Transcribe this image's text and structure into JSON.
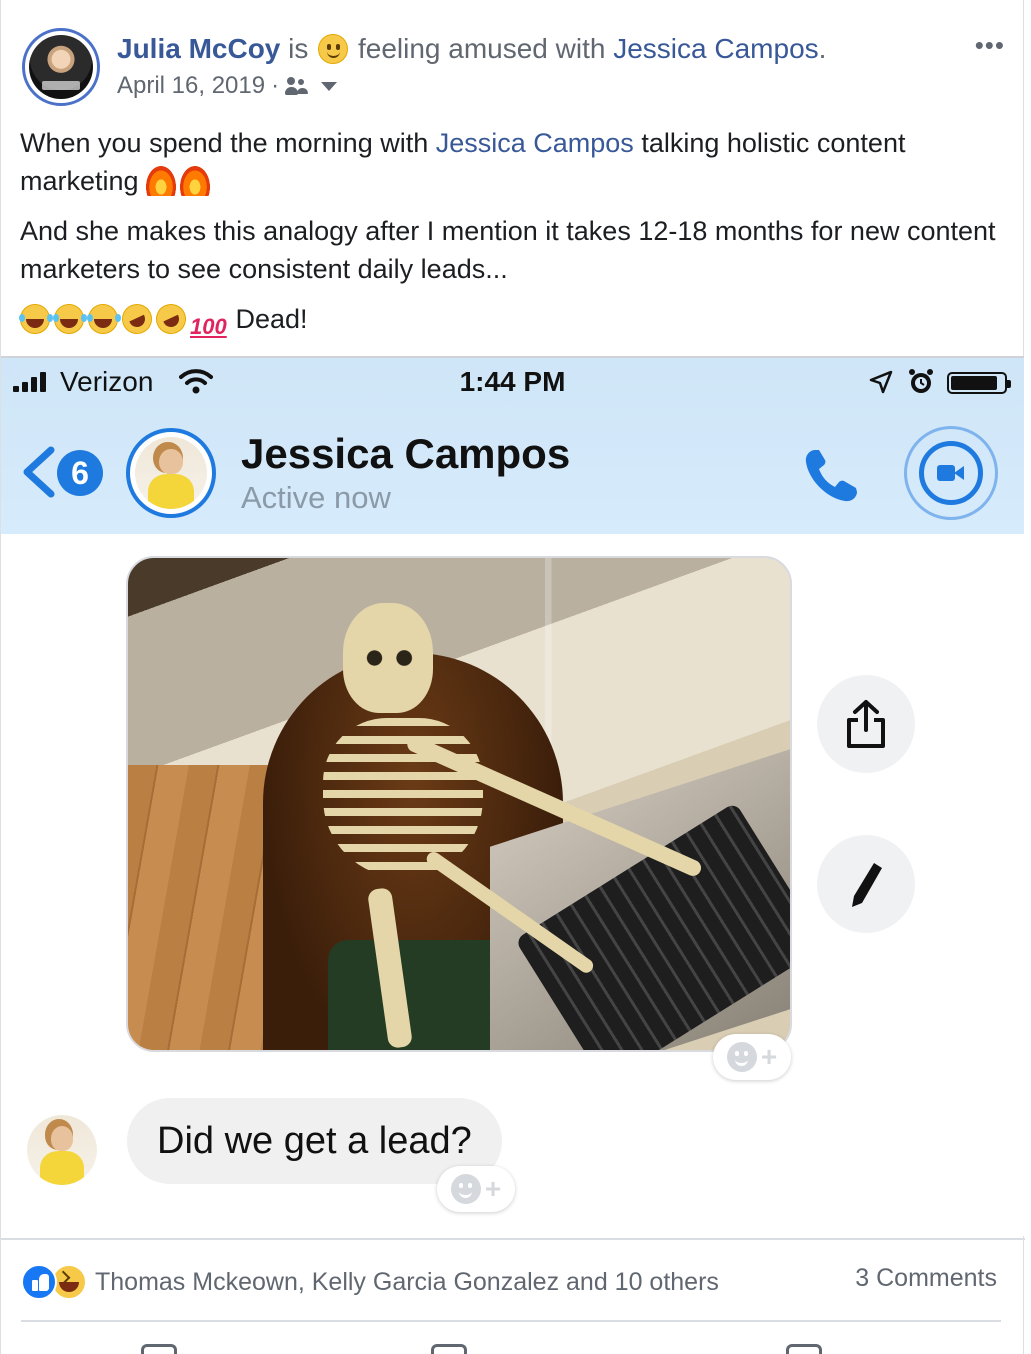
{
  "post": {
    "author": "Julia McCoy",
    "verb": "is",
    "feeling": "feeling amused with",
    "tagged": "Jessica Campos",
    "tagged_suffix": ".",
    "date": "April 16, 2019",
    "date_sep": "·",
    "audience_icon": "friends-icon",
    "more_label": "•••",
    "p1_before": "When you spend the morning with ",
    "p1_link": "Jessica Campos",
    "p1_after": " talking holistic content marketing ",
    "p2": "And she makes this analogy after I mention it takes 12-18 months for new content marketers to see consistent daily leads...",
    "p3_hundred": "100",
    "p3_text": " Dead!"
  },
  "screenshot": {
    "status_bar": {
      "carrier": "Verizon",
      "time": "1:44 PM"
    },
    "header": {
      "back_count": "6",
      "contact_name": "Jessica Campos",
      "contact_status": "Active now"
    },
    "message": "Did we get a lead?"
  },
  "footer": {
    "reactors": "Thomas Mckeown, Kelly Garcia Gonzalez and 10 others",
    "comments": "3 Comments"
  },
  "colors": {
    "link": "#385898",
    "messenger_blue": "#1f7ae0",
    "phone_header_bg": "#cfe6f8",
    "like_blue": "#1877f2"
  }
}
